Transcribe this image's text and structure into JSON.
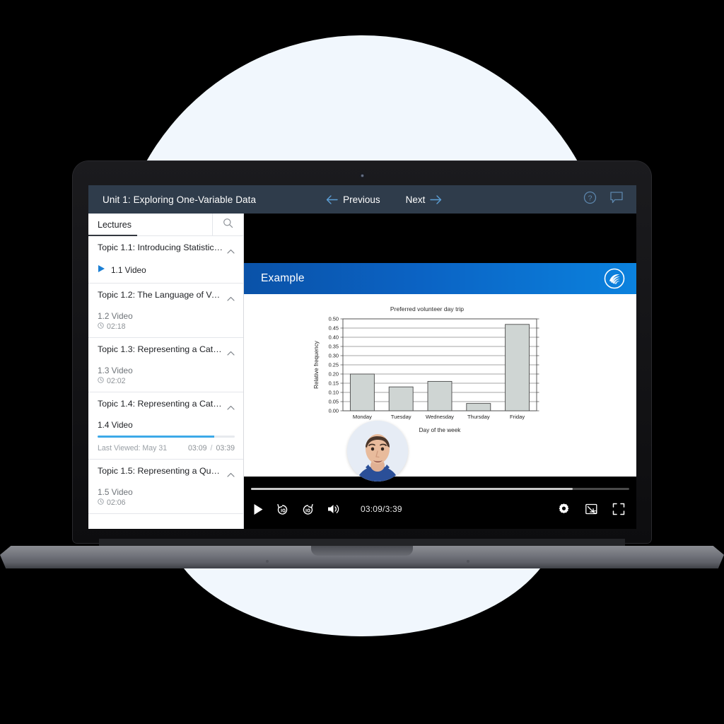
{
  "header": {
    "unit_title": "Unit 1: Exploring One-Variable Data",
    "previous_label": "Previous",
    "next_label": "Next",
    "help_icon": "help-circle-icon",
    "comment_icon": "comment-bubble-icon",
    "bg_color": "#2f3c4b"
  },
  "sidebar": {
    "tab_label": "Lectures",
    "search_icon": "search-icon",
    "topics": [
      {
        "title": "Topic 1.1: Introducing Statistics: ...",
        "lesson_label": "1.1 Video",
        "state": "playing",
        "duration": null,
        "progress": null,
        "last_viewed": null,
        "elapsed": null,
        "total": null
      },
      {
        "title": "Topic 1.2: The Language of Var...",
        "lesson_label": "1.2 Video",
        "state": "idle",
        "duration": "02:18",
        "progress": null,
        "last_viewed": null,
        "elapsed": null,
        "total": null
      },
      {
        "title": "Topic 1.3: Representing a Categ...",
        "lesson_label": "1.3 Video",
        "state": "idle",
        "duration": "02:02",
        "progress": null,
        "last_viewed": null,
        "elapsed": null,
        "total": null
      },
      {
        "title": "Topic 1.4: Representing a Categ...",
        "lesson_label": "1.4 Video",
        "state": "active",
        "duration": null,
        "progress": 85,
        "last_viewed": "Last Viewed: May 31",
        "elapsed": "03:09",
        "separator": "/",
        "total": "03:39"
      },
      {
        "title": "Topic 1.5: Representing a Quan...",
        "lesson_label": "1.5 Video",
        "state": "idle",
        "duration": "02:06",
        "progress": null,
        "last_viewed": null,
        "elapsed": null,
        "total": null
      }
    ],
    "progress_color": "#3da9e8"
  },
  "slide": {
    "title": "Example",
    "logo_icon": "swirl-brand-logo-icon",
    "banner_gradient_start": "#0a52a8",
    "banner_gradient_end": "#0b82de"
  },
  "chart_data": {
    "type": "bar",
    "title": "Preferred volunteer day trip",
    "xlabel": "Day of the week",
    "ylabel": "Relative frequency",
    "categories": [
      "Monday",
      "Tuesday",
      "Wednesday",
      "Thursday",
      "Friday"
    ],
    "values": [
      0.2,
      0.13,
      0.16,
      0.04,
      0.47
    ],
    "ylim": [
      0.0,
      0.5
    ],
    "ytick_step": 0.05,
    "yticks": [
      "0.00",
      "0.05",
      "0.10",
      "0.15",
      "0.20",
      "0.25",
      "0.30",
      "0.35",
      "0.40",
      "0.45",
      "0.50"
    ],
    "grid": true,
    "legend": "none",
    "bar_fill": "#cfd5d3",
    "bar_stroke": "#4a4a4a"
  },
  "player": {
    "time_display": "03:09/3:39",
    "progress_percent": 85,
    "play_icon": "play-icon",
    "rewind_icon": "rewind-10-icon",
    "forward_icon": "forward-10-icon",
    "volume_icon": "volume-icon",
    "settings_icon": "gear-icon",
    "pip_icon": "picture-in-picture-icon",
    "fullscreen_icon": "fullscreen-icon"
  },
  "presenter": {
    "alt": "presenter-video-thumbnail"
  }
}
